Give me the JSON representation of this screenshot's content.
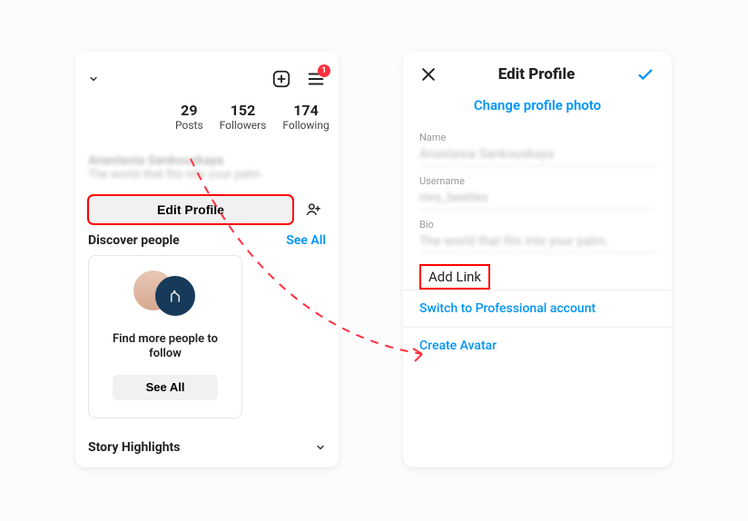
{
  "profile": {
    "stats": {
      "posts": {
        "count": "29",
        "label": "Posts"
      },
      "followers": {
        "count": "152",
        "label": "Followers"
      },
      "following": {
        "count": "174",
        "label": "Following"
      }
    },
    "display_name": "Anastasia Sankouskaya",
    "bio": "The world that fits into your palm.",
    "edit_profile_label": "Edit Profile",
    "notification_badge": "1",
    "discover": {
      "title": "Discover people",
      "see_all": "See All",
      "find_more": "Find more people to follow",
      "card_button": "See All"
    },
    "story_highlights": "Story Highlights"
  },
  "edit_screen": {
    "title": "Edit Profile",
    "change_photo": "Change profile photo",
    "fields": {
      "name": {
        "label": "Name",
        "value": "Anastasia Sankouskaya"
      },
      "username": {
        "label": "Username",
        "value": "mrs_beetles"
      },
      "bio": {
        "label": "Bio",
        "value": "The world that fits into your palm."
      }
    },
    "add_link": "Add Link",
    "switch_pro": "Switch to Professional account",
    "create_avatar": "Create Avatar"
  }
}
